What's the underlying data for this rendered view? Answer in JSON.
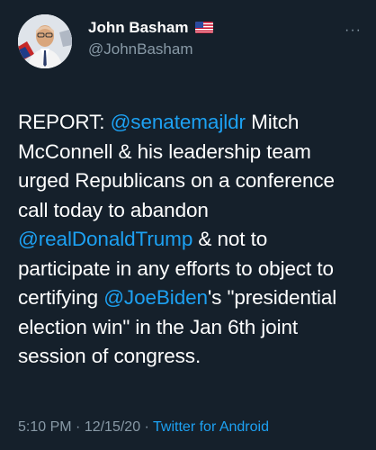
{
  "author": {
    "name": "John Basham",
    "handle": "@JohnBasham",
    "flag_icon": "us-flag-icon"
  },
  "more_icon": "ellipsis-icon",
  "more_label": "···",
  "tweet": {
    "segments": [
      {
        "text": "REPORT: ",
        "mention": false
      },
      {
        "text": "@senatemajldr",
        "mention": true
      },
      {
        "text": " Mitch McConnell & his leadership team urged Republicans on a conference call today to abandon ",
        "mention": false
      },
      {
        "text": "@realDonaldTrump",
        "mention": true
      },
      {
        "text": " & not to participate in any efforts to object to certifying ",
        "mention": false
      },
      {
        "text": "@JoeBiden",
        "mention": true
      },
      {
        "text": "'s \"presidential election win\" in the Jan 6th joint session of congress.",
        "mention": false
      }
    ]
  },
  "meta": {
    "time": "5:10 PM",
    "separator": " · ",
    "date": "12/15/20",
    "separator2": " · ",
    "source": "Twitter for Android"
  },
  "colors": {
    "background": "#15202b",
    "text": "#ffffff",
    "secondary": "#8899a6",
    "link": "#1da1f2"
  }
}
